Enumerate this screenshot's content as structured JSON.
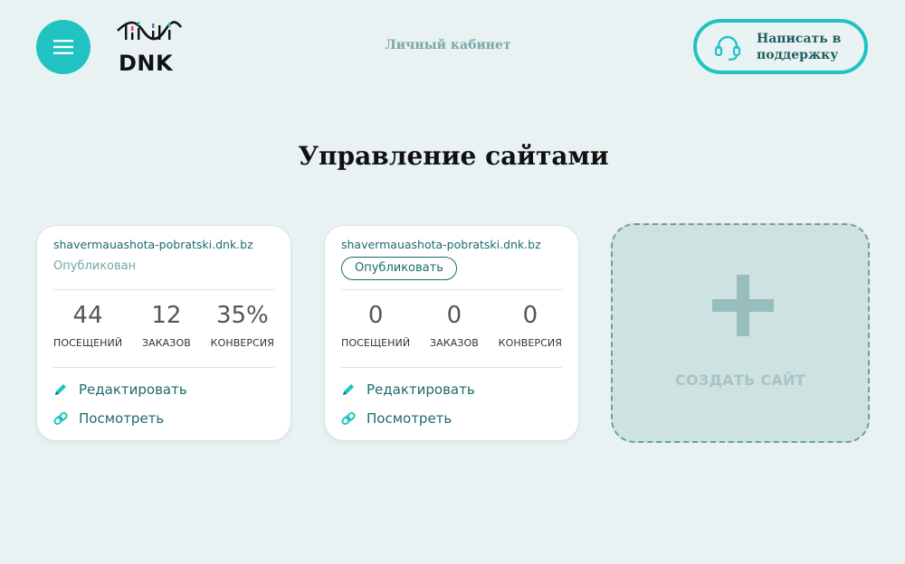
{
  "header": {
    "menu_icon": "hamburger-icon",
    "logo_text": "DNK",
    "cabinet_link": "Личный кабинет",
    "support_label": "Написать в поддержку",
    "support_icon": "headset-icon",
    "accent_color": "#20c3c2"
  },
  "page_title": "Управление сайтами",
  "sites": [
    {
      "domain": "shavermauashota-pobratski.dnk.bz",
      "status": "Опубликован",
      "stats": [
        {
          "value": "44",
          "label": "ПОСЕЩЕНИЙ"
        },
        {
          "value": "12",
          "label": "ЗАКАЗОВ"
        },
        {
          "value": "35%",
          "label": "КОНВЕРСИЯ"
        }
      ],
      "edit_label": "Редактировать",
      "view_label": "Посмотреть"
    },
    {
      "domain": "shavermauashota-pobratski.dnk.bz",
      "publish_label": "Опубликовать",
      "stats": [
        {
          "value": "0",
          "label": "ПОСЕЩЕНИЙ"
        },
        {
          "value": "0",
          "label": "ЗАКАЗОВ"
        },
        {
          "value": "0",
          "label": "КОНВЕРСИЯ"
        }
      ],
      "edit_label": "Редактировать",
      "view_label": "Посмотреть"
    }
  ],
  "create_site": {
    "label": "СОЗДАТЬ САЙТ",
    "icon": "plus-icon"
  }
}
